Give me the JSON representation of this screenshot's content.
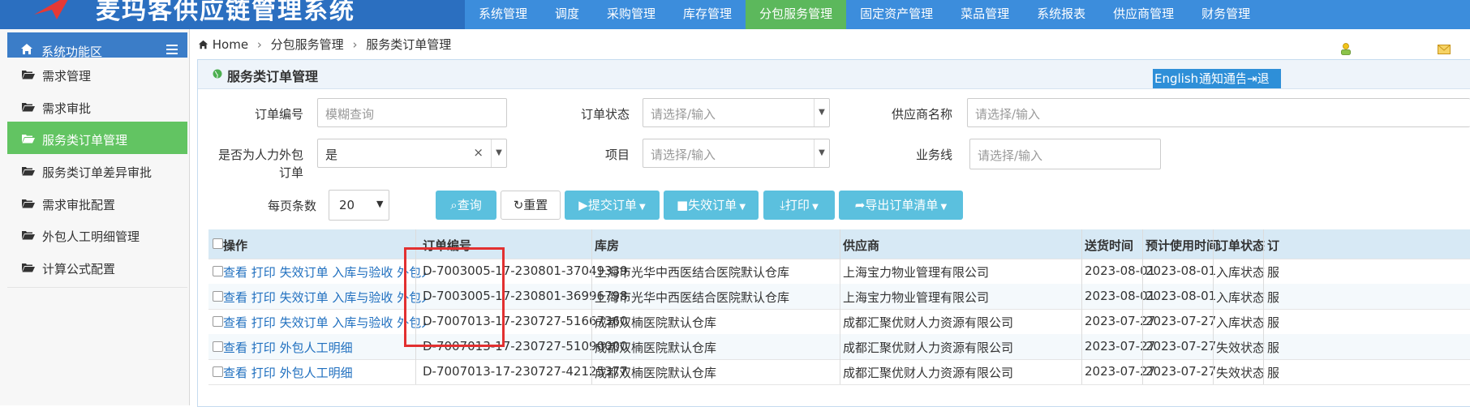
{
  "header": {
    "app_title": "麦玛客供应链管理系统",
    "nav": [
      "系统管理",
      "调度",
      "采购管理",
      "库存管理",
      "分包服务管理",
      "固定资产管理",
      "菜品管理",
      "系统报表",
      "供应商管理",
      "财务管理"
    ],
    "active_nav": "分包服务管理",
    "colors": {
      "header_bg": "#2b6fc0",
      "nav_bg": "#3c8ddc",
      "active": "#5cb85c",
      "logo": "#e53935"
    }
  },
  "sidebar": {
    "title": "系统功能区",
    "items": [
      {
        "label": "需求管理",
        "active": false
      },
      {
        "label": "需求审批",
        "active": false
      },
      {
        "label": "服务类订单管理",
        "active": true
      },
      {
        "label": "服务类订单差异审批",
        "active": false
      },
      {
        "label": "需求审批配置",
        "active": false
      },
      {
        "label": "外包人工明细管理",
        "active": false
      },
      {
        "label": "计算公式配置",
        "active": false
      }
    ]
  },
  "breadcrumb": {
    "home": "Home",
    "level1": "分包服务管理",
    "level2": "服务类订单管理"
  },
  "panel": {
    "title": "服务类订单管理",
    "buttons": [
      "English",
      "通知通告",
      "退"
    ]
  },
  "filters": {
    "order_no": {
      "label": "订单编号",
      "placeholder": "模糊查询"
    },
    "order_status": {
      "label": "订单状态",
      "placeholder": "请选择/输入"
    },
    "supplier": {
      "label": "供应商名称",
      "placeholder": "请选择/输入"
    },
    "outsourcing": {
      "label_line1": "是否为人力外包",
      "label_line2": "订单",
      "value": "是"
    },
    "project": {
      "label": "项目",
      "placeholder": "请选择/输入"
    },
    "business_line": {
      "label": "业务线",
      "placeholder": "请选择/输入"
    },
    "page_size": {
      "label": "每页条数",
      "value": "20"
    }
  },
  "toolbar": {
    "query": "查询",
    "reset": "重置",
    "submit": "提交订单",
    "invalidate": "失效订单",
    "print": "打印",
    "export": "导出订单清单"
  },
  "table": {
    "headers": [
      "操作",
      "订单编号",
      "库房",
      "供应商",
      "送货时间",
      "预计使用时间",
      "订单状态",
      "订"
    ],
    "rows": [
      {
        "actions": [
          "查看",
          "打印",
          "失效订单",
          "入库与验收",
          "外包人工明细"
        ],
        "order_no": "D-7003005-17-230801-37049339",
        "warehouse": "上海市光华中西医结合医院默认仓库",
        "supplier": "上海宝力物业管理有限公司",
        "delivery": "2023-08-01",
        "expected": "2023-08-01",
        "status": "入库状态",
        "extra": "服"
      },
      {
        "actions": [
          "查看",
          "打印",
          "失效订单",
          "入库与验收",
          "外包人工明细"
        ],
        "order_no": "D-7003005-17-230801-36996798",
        "warehouse": "上海市光华中西医结合医院默认仓库",
        "supplier": "上海宝力物业管理有限公司",
        "delivery": "2023-08-01",
        "expected": "2023-08-01",
        "status": "入库状态",
        "extra": "服"
      },
      {
        "actions": [
          "查看",
          "打印",
          "失效订单",
          "入库与验收",
          "外包人工明细"
        ],
        "order_no": "D-7007013-17-230727-51667360",
        "warehouse": "成都双楠医院默认仓库",
        "supplier": "成都汇聚优财人力资源有限公司",
        "delivery": "2023-07-27",
        "expected": "2023-07-27",
        "status": "入库状态",
        "extra": "服"
      },
      {
        "actions": [
          "查看",
          "打印",
          "外包人工明细"
        ],
        "order_no": "D-7007013-17-230727-51090000",
        "warehouse": "成都双楠医院默认仓库",
        "supplier": "成都汇聚优财人力资源有限公司",
        "delivery": "2023-07-27",
        "expected": "2023-07-27",
        "status": "失效状态",
        "extra": "服"
      },
      {
        "actions": [
          "查看",
          "打印",
          "外包人工明细"
        ],
        "order_no": "D-7007013-17-230727-42125377",
        "warehouse": "成都双楠医院默认仓库",
        "supplier": "成都汇聚优财人力资源有限公司",
        "delivery": "2023-07-27",
        "expected": "2023-07-27",
        "status": "失效状态",
        "extra": "服"
      }
    ]
  }
}
